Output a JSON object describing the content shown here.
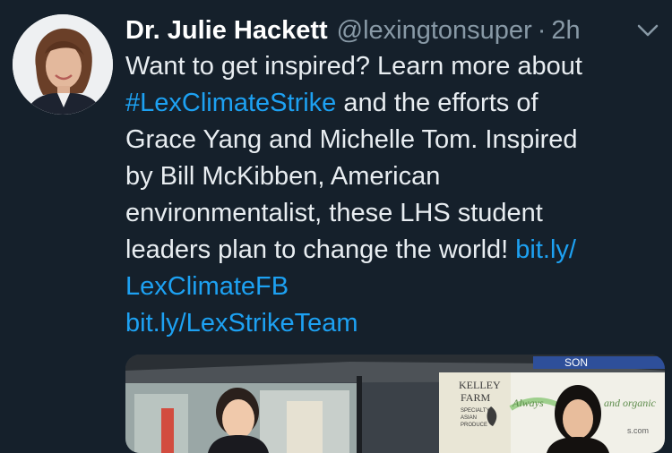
{
  "tweet": {
    "author_name": "Dr. Julie Hackett",
    "handle": "@lexingtonsuper",
    "separator": "·",
    "time": "2h",
    "lines": [
      [
        {
          "t": "Want to get inspired? Learn more about",
          "link": false
        }
      ],
      [
        {
          "t": "#LexClimateStrike",
          "link": true
        },
        {
          "t": " and the efforts of",
          "link": false
        }
      ],
      [
        {
          "t": "Grace Yang and Michelle Tom.  Inspired",
          "link": false
        }
      ],
      [
        {
          "t": "by Bill McKibben, American",
          "link": false
        }
      ],
      [
        {
          "t": "environmentalist, these LHS student",
          "link": false
        }
      ],
      [
        {
          "t": "leaders plan to change the world! ",
          "link": false
        },
        {
          "t": "bit.ly/",
          "link": true
        }
      ],
      [
        {
          "t": "LexClimateFB",
          "link": true
        }
      ],
      [
        {
          "t": "bit.ly/LexStrikeTeam",
          "link": true
        }
      ]
    ]
  },
  "media": {
    "banner_lines": [
      "KELLEY",
      "FARM",
      "SPECIALTY",
      "ASIAN",
      "PRODUCE"
    ],
    "sign_left": "Always",
    "sign_right": "and organic",
    "sign_small": "s.com",
    "top_banner": "SON"
  },
  "colors": {
    "background": "#15202b",
    "link": "#1da1f2",
    "muted": "#8899a6"
  },
  "icons": {
    "menu": "chevron-down-icon"
  }
}
